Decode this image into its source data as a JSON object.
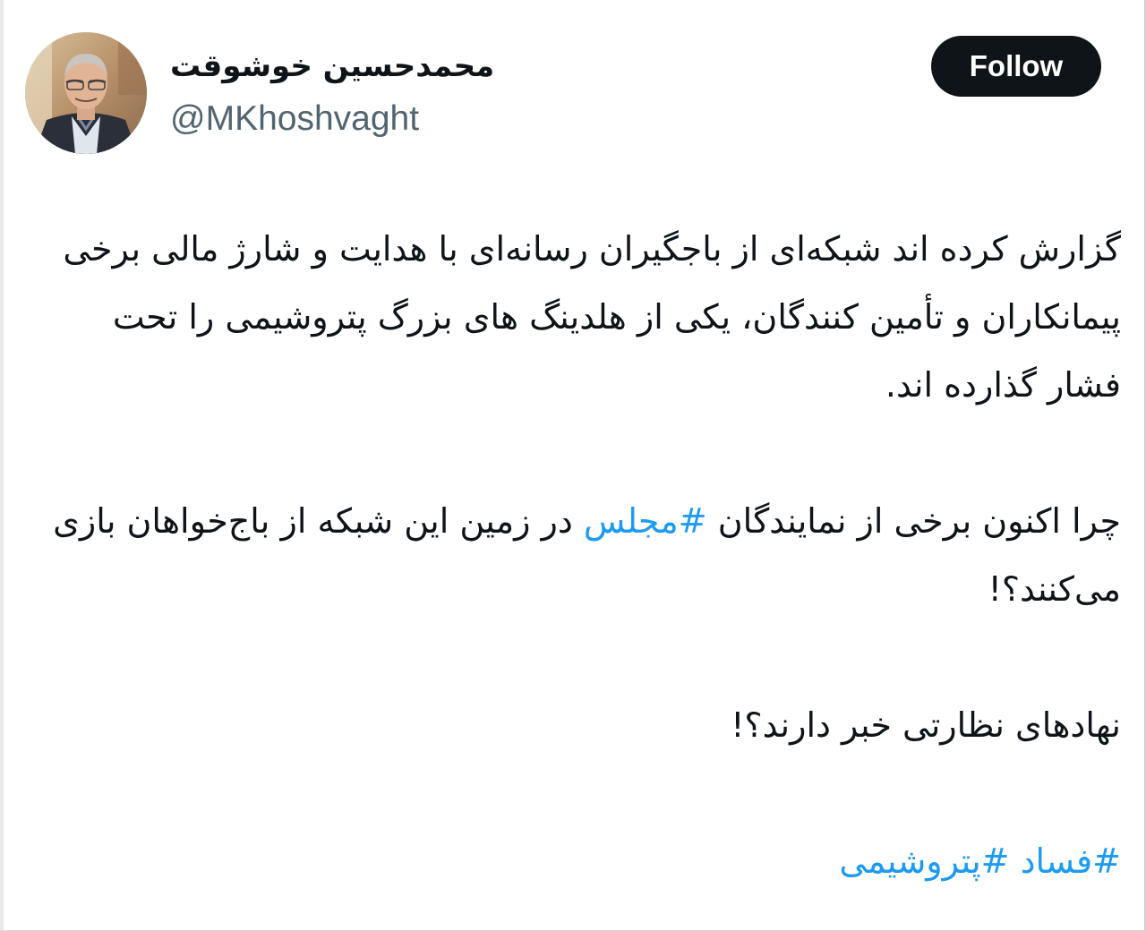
{
  "author": {
    "display_name": "محمدحسین خوشوقت",
    "handle": "@MKhoshvaght"
  },
  "follow_button": {
    "label": "Follow"
  },
  "tweet": {
    "paragraph_1": "گزارش کرده اند شبکه‌ای از باجگیران رسانه‌ای با هدایت و شارژ مالی برخی پیمانکاران و تأمین کنندگان، یکی از هلدینگ های بزرگ پتروشیمی را تحت فشار گذارده اند.",
    "paragraph_2_before": "چرا اکنون برخی از نمایندگان ",
    "paragraph_2_hashtag": "#مجلس",
    "paragraph_2_after": " در زمین این شبکه از باج‌خواهان بازی می‌کنند؟!",
    "paragraph_3": "نهادهای نظارتی خبر دارند؟!",
    "hashtag_1": "#فساد",
    "hashtag_2": "#پتروشیمی"
  },
  "colors": {
    "text": "#0f1419",
    "handle": "#536471",
    "hashtag": "#1d9bf0",
    "button_bg": "#0f1419",
    "button_text": "#ffffff"
  },
  "icons": {
    "avatar": "profile-photo"
  }
}
